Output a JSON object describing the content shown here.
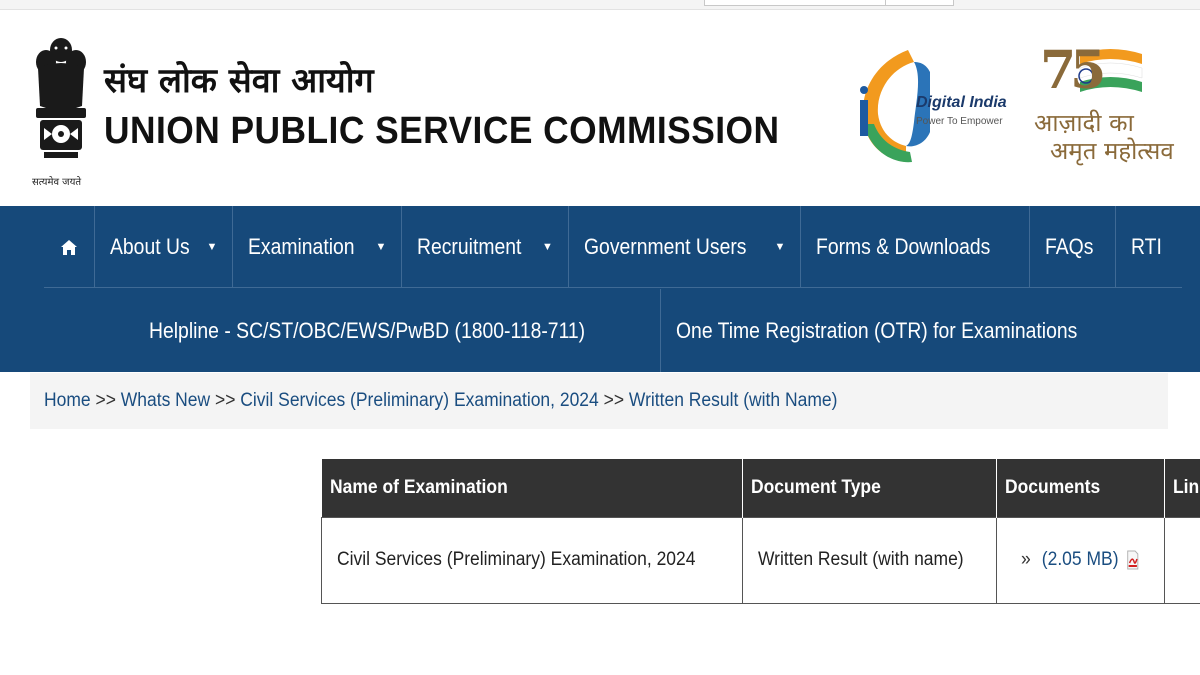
{
  "header": {
    "title_hindi": "संघ लोक सेवा आयोग",
    "title_english": "UNION PUBLIC SERVICE COMMISSION",
    "emblem_motto": "सत्यमेव जयते",
    "digital_india": {
      "title": "Digital India",
      "tagline": "Power To Empower"
    },
    "azadi": {
      "number": "75",
      "line1": "आज़ादी का",
      "line2": "अमृत महोत्सव"
    }
  },
  "nav": {
    "home_icon": "home-icon",
    "row1": [
      {
        "label": "About Us",
        "dropdown": true
      },
      {
        "label": "Examination",
        "dropdown": true
      },
      {
        "label": "Recruitment",
        "dropdown": true
      },
      {
        "label": "Government Users",
        "dropdown": true
      },
      {
        "label": "Forms & Downloads",
        "dropdown": false
      },
      {
        "label": "FAQs",
        "dropdown": false
      },
      {
        "label": "RTI",
        "dropdown": false
      }
    ],
    "row2": [
      {
        "label": "Helpline - SC/ST/OBC/EWS/PwBD (1800-118-711)"
      },
      {
        "label": "One Time Registration (OTR) for Examinations"
      }
    ]
  },
  "breadcrumb": {
    "items": [
      "Home",
      "Whats New",
      "Civil Services (Preliminary) Examination, 2024",
      "Written Result (with Name)"
    ],
    "separator": ">>"
  },
  "table": {
    "headers": [
      "Name of Examination",
      "Document Type",
      "Documents",
      "Link"
    ],
    "rows": [
      {
        "exam": "Civil Services (Preliminary) Examination, 2024",
        "doc_type": "Written Result (with name)",
        "doc_chevron": "»",
        "doc_size": "(2.05 MB)",
        "doc_icon": "pdf-icon",
        "link": ""
      }
    ]
  },
  "colors": {
    "nav_bg": "#16497a",
    "table_header_bg": "#333333",
    "link": "#1a4d80",
    "breadcrumb_bg": "#f4f4f4"
  }
}
